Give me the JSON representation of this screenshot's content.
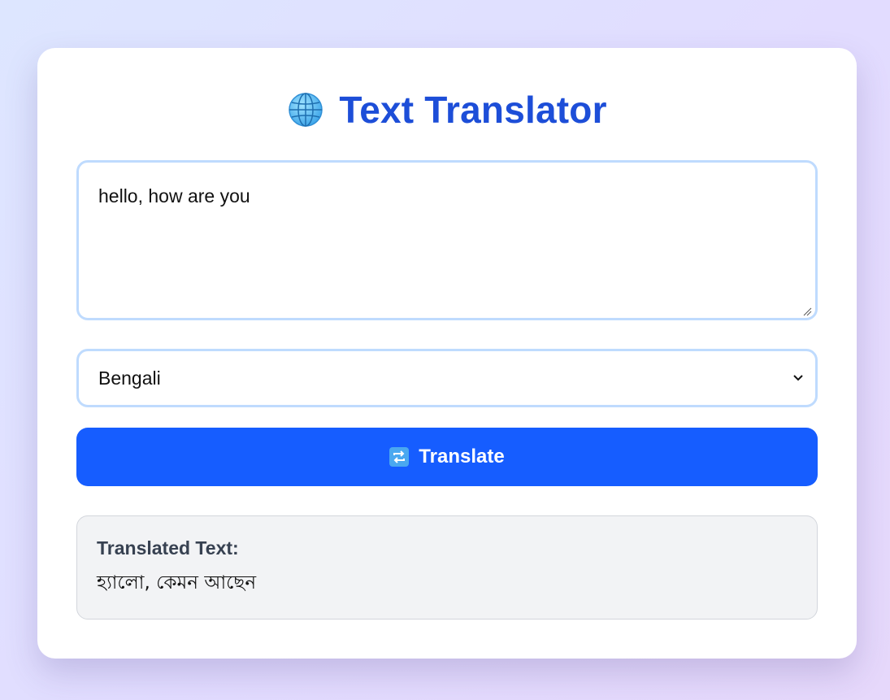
{
  "header": {
    "title": "Text Translator",
    "icon": "globe-icon"
  },
  "input": {
    "value": "hello, how are you"
  },
  "language_select": {
    "selected": "Bengali",
    "icon": "chevron-down-icon"
  },
  "translate_button": {
    "label": "Translate",
    "icon": "repeat-icon"
  },
  "result": {
    "heading": "Translated Text:",
    "text": "হ্যালো, কেমন আছেন"
  },
  "colors": {
    "accent": "#165dff",
    "title": "#1d4ed8",
    "input_border": "#bfdbfe",
    "result_bg": "#f2f3f5"
  }
}
